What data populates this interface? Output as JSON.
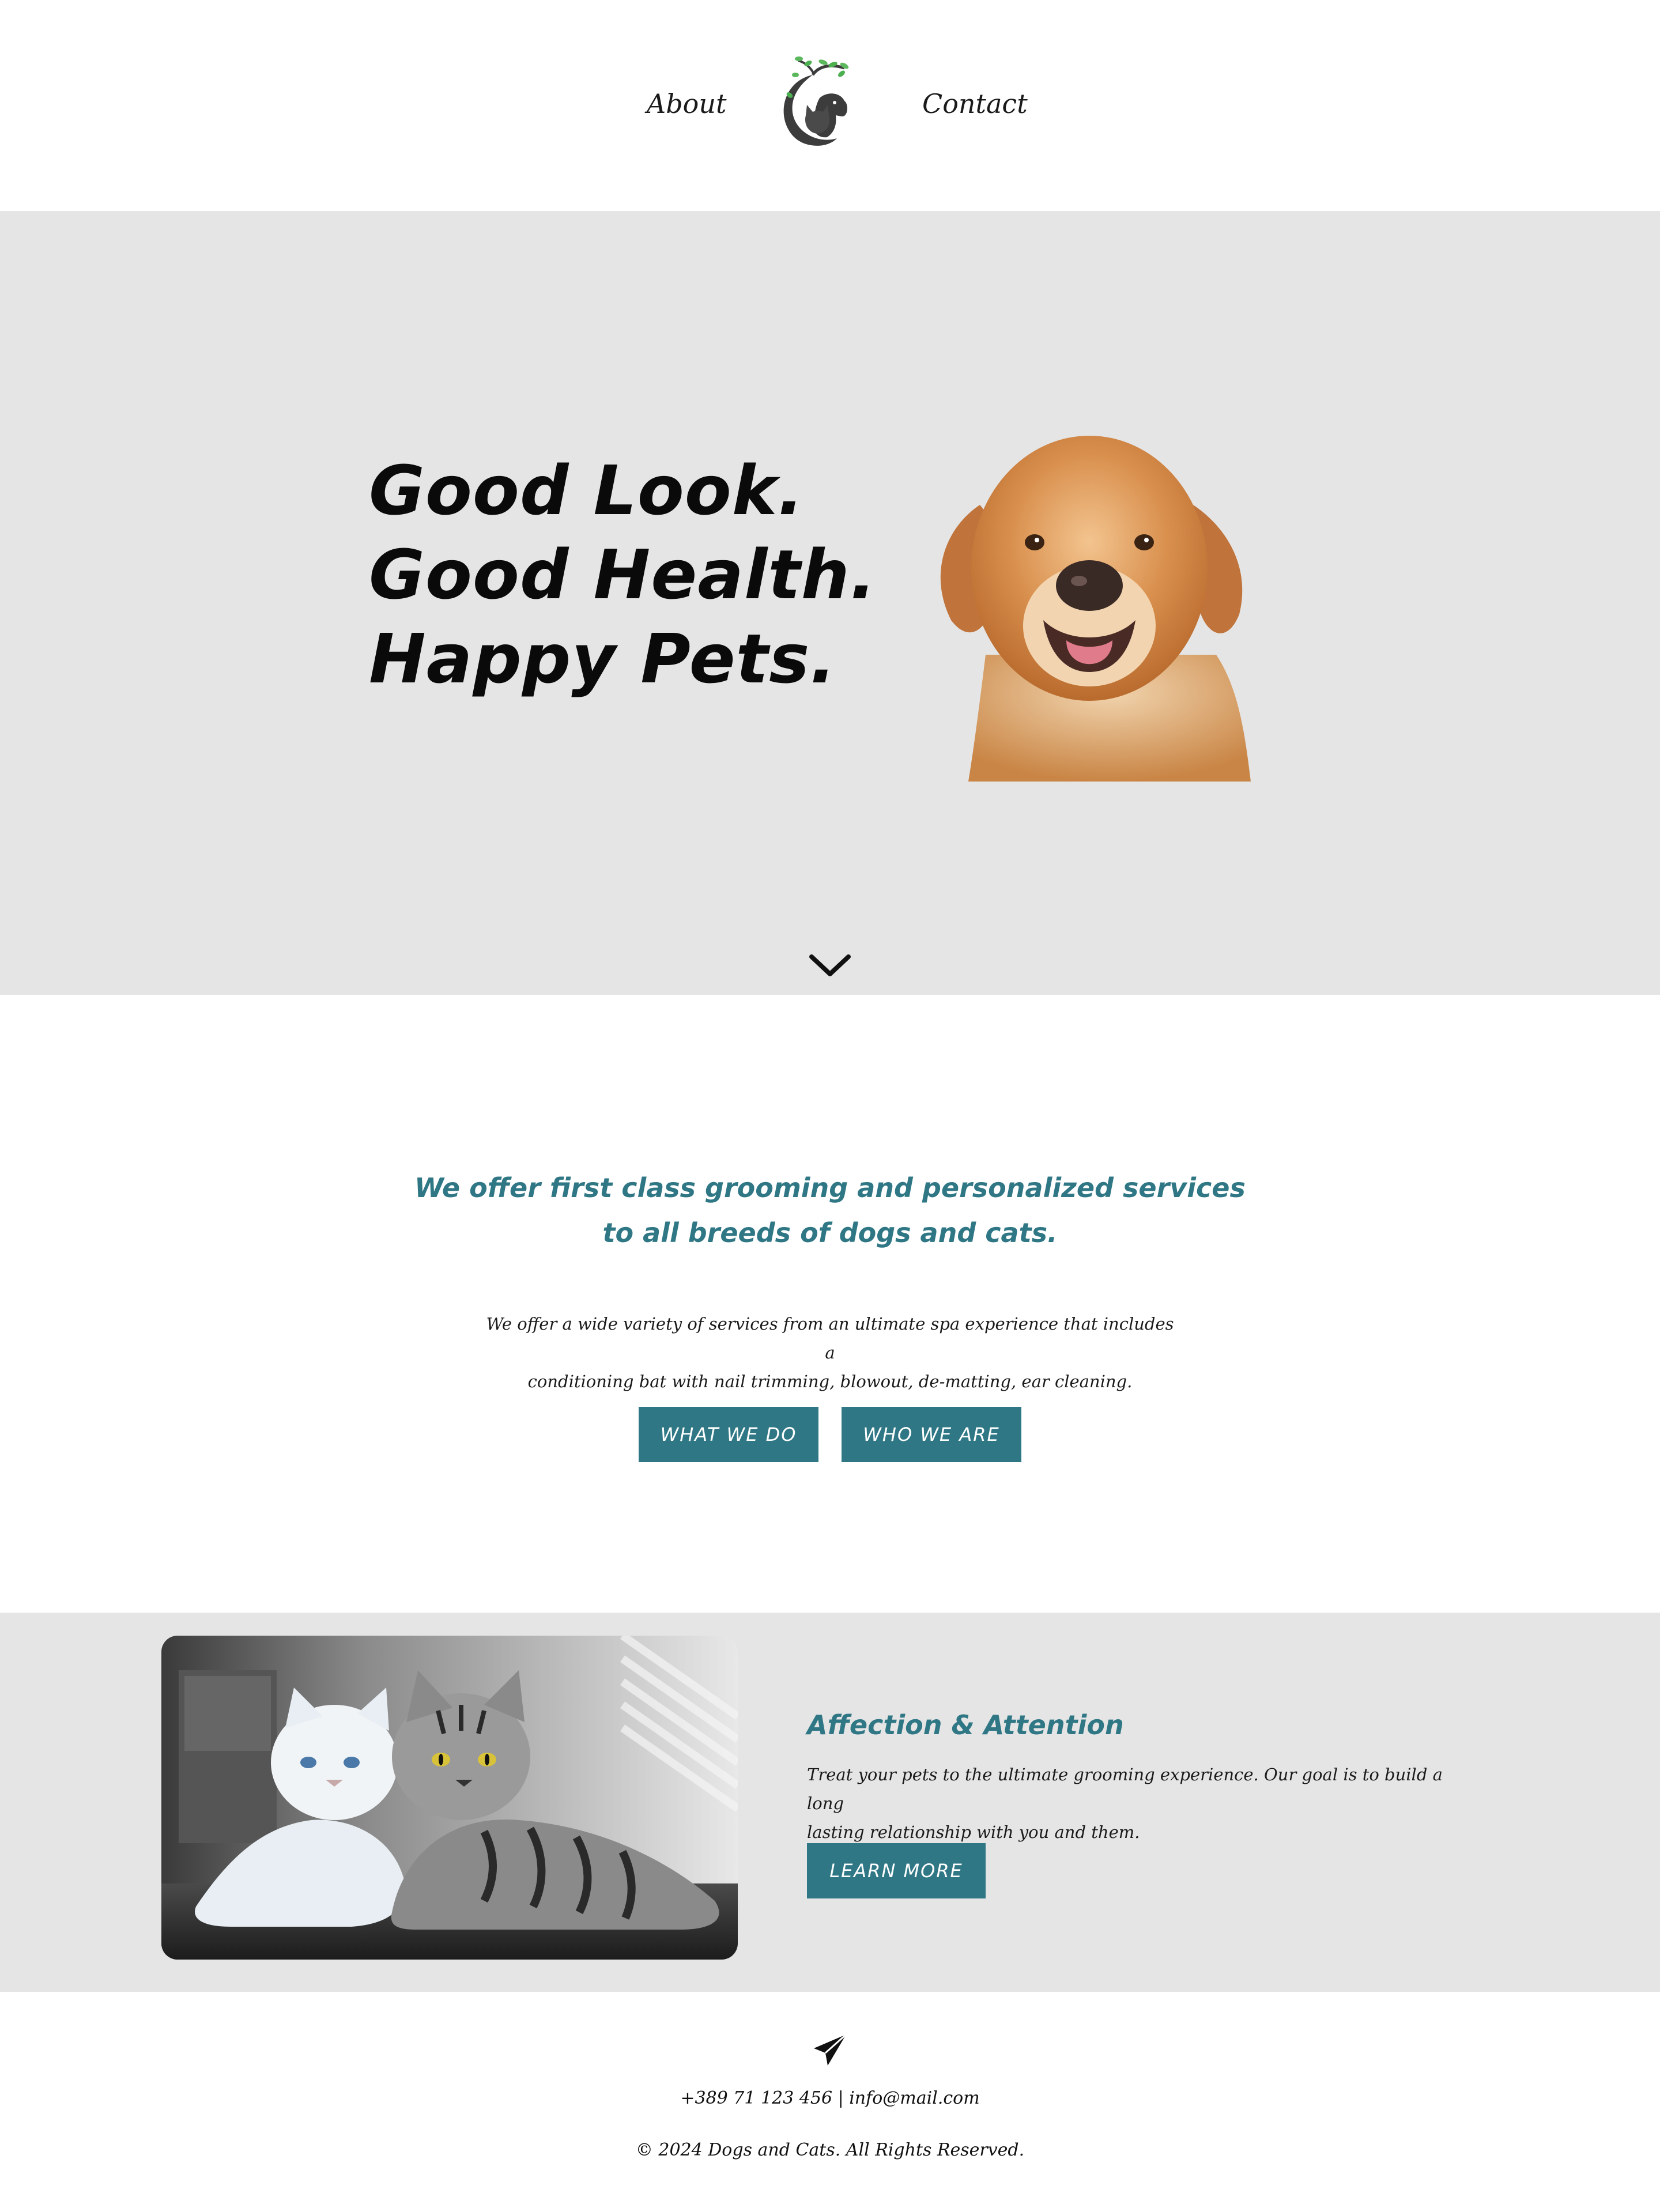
{
  "nav": {
    "about": "About",
    "contact": "Contact",
    "logo_icon": "dog-cat-tree-logo-icon"
  },
  "hero": {
    "title_lines": [
      "Good Look.",
      "Good Health.",
      "Happy Pets."
    ],
    "image": "golden-retriever-photo",
    "scroll_icon": "chevron-down-icon"
  },
  "intro": {
    "heading_line1": "We offer first class grooming and personalized services",
    "heading_line2": "to all breeds of dogs and cats.",
    "text_line1": "We offer a wide variety of services from an ultimate spa experience that includes a",
    "text_line2": "conditioning bat with nail trimming, blowout, de-matting, ear cleaning.",
    "button_what": "WHAT WE DO",
    "button_who": "WHO WE ARE"
  },
  "feature": {
    "image": "two-cats-photo",
    "title": "Affection & Attention",
    "text_line1": "Treat your pets to the ultimate grooming experience. Our goal is to build a long",
    "text_line2": "lasting relationship with you and them.",
    "button": "LEARN MORE"
  },
  "footer": {
    "icon": "paper-plane-icon",
    "contact": "+389 71 123 456 | info@mail.com",
    "copyright": "© 2024 Dogs and Cats. All Rights Reserved."
  },
  "colors": {
    "accent": "#2f7785",
    "section_gray": "#e5e5e5",
    "text": "#111111"
  }
}
